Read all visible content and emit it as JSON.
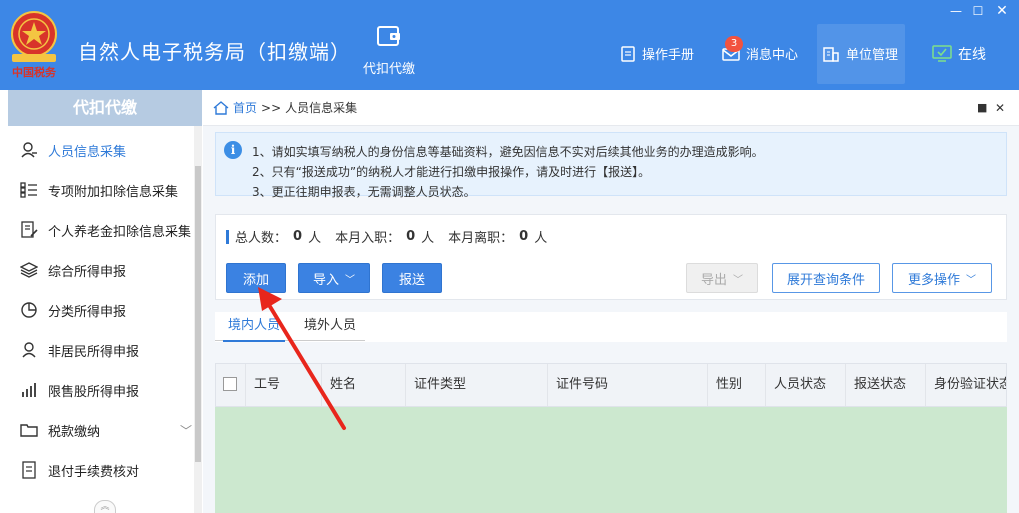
{
  "header": {
    "title": "自然人电子税务局（扣缴端）",
    "logo_text": "中国税务",
    "nav_main_label": "代扣代缴",
    "manual_label": "操作手册",
    "messages_label": "消息中心",
    "messages_badge": "3",
    "unit_label": "单位管理",
    "online_label": "在线",
    "colors": {
      "header_bg": "#3d87e6",
      "badge": "#f2533f"
    }
  },
  "sidebar": {
    "title": "代扣代缴",
    "items": [
      {
        "label": "人员信息采集",
        "icon": "user-icon"
      },
      {
        "label": "专项附加扣除信息采集",
        "icon": "list-icon"
      },
      {
        "label": "个人养老金扣除信息采集",
        "icon": "document-edit-icon"
      },
      {
        "label": "综合所得申报",
        "icon": "layers-icon"
      },
      {
        "label": "分类所得申报",
        "icon": "pie-chart-icon"
      },
      {
        "label": "非居民所得申报",
        "icon": "user-outline-icon"
      },
      {
        "label": "限售股所得申报",
        "icon": "bar-chart-icon"
      },
      {
        "label": "税款缴纳",
        "icon": "folder-icon"
      },
      {
        "label": "退付手续费核对",
        "icon": "document-icon"
      }
    ],
    "collapse_icon": "double-chevron-up-icon"
  },
  "breadcrumb": {
    "home": "首页",
    "sep": ">>",
    "current": "人员信息采集"
  },
  "notice": {
    "lines": [
      "1、请如实填写纳税人的身份信息等基础资料，避免因信息不实对后续其他业务的办理造成影响。",
      "2、只有“报送成功”的纳税人才能进行扣缴申报操作，请及时进行【报送】。",
      "3、更正往期申报表，无需调整人员状态。"
    ]
  },
  "stats": {
    "total_label": "总人数：",
    "total_value": "0",
    "unit": "人",
    "joined_label": "本月入职：",
    "joined_value": "0",
    "left_label": "本月离职：",
    "left_value": "0"
  },
  "toolbar": {
    "add": "添加",
    "import": "导入",
    "submit": "报送",
    "export": "导出",
    "expand_query": "展开查询条件",
    "more": "更多操作"
  },
  "tabs": [
    {
      "label": "境内人员",
      "active": true
    },
    {
      "label": "境外人员",
      "active": false
    }
  ],
  "table": {
    "columns": [
      "工号",
      "姓名",
      "证件类型",
      "证件号码",
      "性别",
      "人员状态",
      "报送状态",
      "身份验证状态"
    ],
    "rows": []
  }
}
